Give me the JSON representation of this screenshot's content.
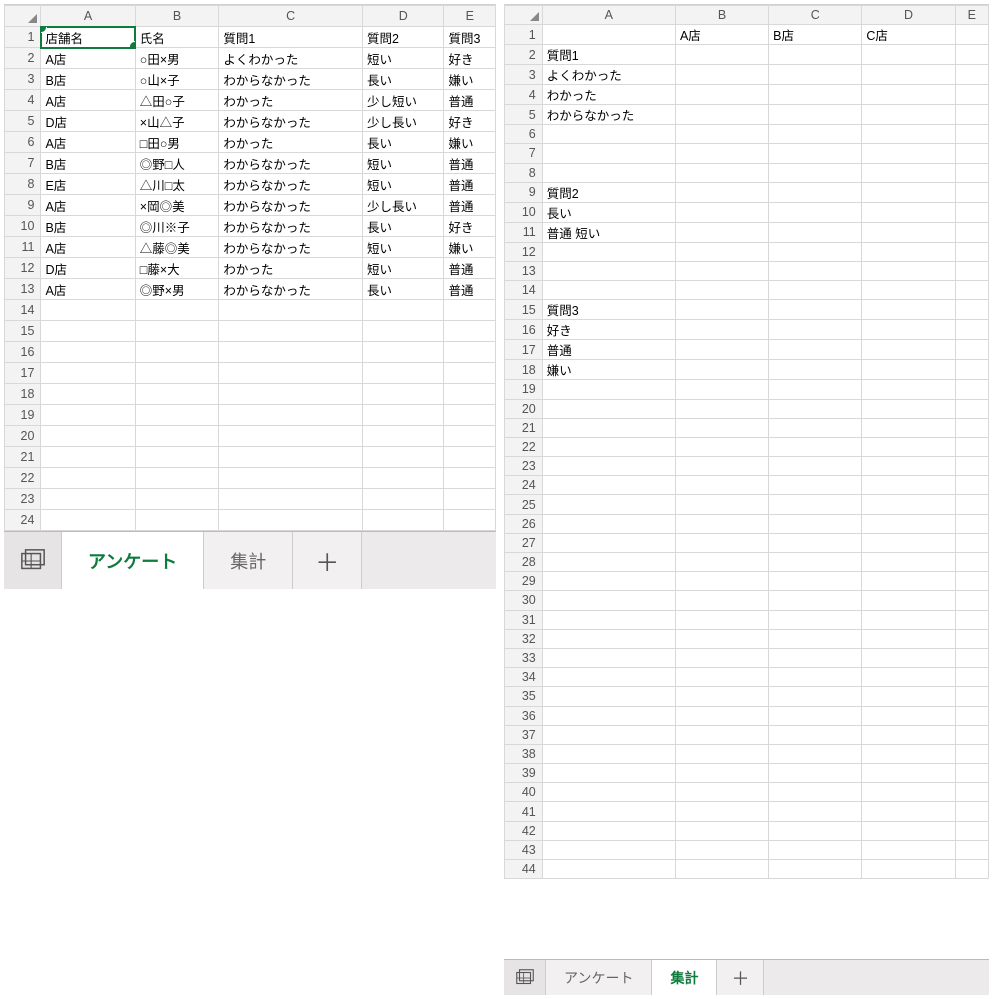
{
  "left": {
    "columns": [
      "A",
      "B",
      "C",
      "D",
      "E"
    ],
    "headers": {
      "A": "店舗名",
      "B": "氏名",
      "C": "質問1",
      "D": "質問2",
      "E": "質問3"
    },
    "rows": [
      {
        "A": "A店",
        "B": "○田×男",
        "C": "よくわかった",
        "D": "短い",
        "E": "好き"
      },
      {
        "A": "B店",
        "B": "○山×子",
        "C": "わからなかった",
        "D": "長い",
        "E": "嫌い"
      },
      {
        "A": "A店",
        "B": "△田○子",
        "C": "わかった",
        "D": "少し短い",
        "E": "普通"
      },
      {
        "A": "D店",
        "B": "×山△子",
        "C": "わからなかった",
        "D": "少し長い",
        "E": "好き"
      },
      {
        "A": "A店",
        "B": "□田○男",
        "C": "わかった",
        "D": "長い",
        "E": "嫌い"
      },
      {
        "A": "B店",
        "B": "◎野□人",
        "C": "わからなかった",
        "D": "短い",
        "E": "普通"
      },
      {
        "A": "E店",
        "B": "△川□太",
        "C": "わからなかった",
        "D": "短い",
        "E": "普通"
      },
      {
        "A": "A店",
        "B": "×岡◎美",
        "C": "わからなかった",
        "D": "少し長い",
        "E": "普通"
      },
      {
        "A": "B店",
        "B": "◎川※子",
        "C": "わからなかった",
        "D": "長い",
        "E": "好き"
      },
      {
        "A": "A店",
        "B": "△藤◎美",
        "C": "わからなかった",
        "D": "短い",
        "E": "嫌い"
      },
      {
        "A": "D店",
        "B": "□藤×大",
        "C": "わかった",
        "D": "短い",
        "E": "普通"
      },
      {
        "A": "A店",
        "B": "◎野×男",
        "C": "わからなかった",
        "D": "長い",
        "E": "普通"
      }
    ],
    "emptyRows": 11,
    "tabs": {
      "active": "アンケート",
      "other": "集計",
      "plus": "＋"
    },
    "selectedCell": "A1"
  },
  "right": {
    "columns": [
      "A",
      "B",
      "C",
      "D",
      "E"
    ],
    "row1": {
      "A": "",
      "B": "A店",
      "C": "B店",
      "D": "C店",
      "E": ""
    },
    "cells": {
      "2": "質問1",
      "3": "よくわかった",
      "4": "わかった",
      "5": "わからなかった",
      "9": "質問2",
      "10": "長い",
      "11": "普通 短い",
      "15": "質問3",
      "16": "好き",
      "17": "普通",
      "18": "嫌い"
    },
    "totalRows": 44,
    "tabs": {
      "active": "集計",
      "other": "アンケート",
      "plus": "＋"
    }
  }
}
